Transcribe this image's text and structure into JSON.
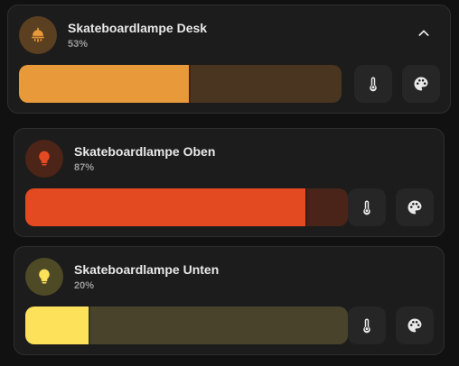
{
  "lights": [
    {
      "name": "Skateboardlampe Desk",
      "percent_label": "53%",
      "brightness": 0.53,
      "icon": "ceiling-lamp-icon",
      "fill_color": "#e8993a",
      "track_color": "#4a3520",
      "icon_bg": "#5a3f20",
      "icon_color": "#e8993a",
      "expanded": true
    },
    {
      "name": "Skateboardlampe Oben",
      "percent_label": "87%",
      "brightness": 0.87,
      "icon": "lightbulb-icon",
      "fill_color": "#e34a21",
      "track_color": "#4a2419",
      "icon_bg": "#4d2418",
      "icon_color": "#e34a21"
    },
    {
      "name": "Skateboardlampe Unten",
      "percent_label": "20%",
      "brightness": 0.2,
      "icon": "lightbulb-icon",
      "fill_color": "#fde15a",
      "track_color": "#48432a",
      "icon_bg": "#4e4a26",
      "icon_color": "#fde15a"
    }
  ]
}
